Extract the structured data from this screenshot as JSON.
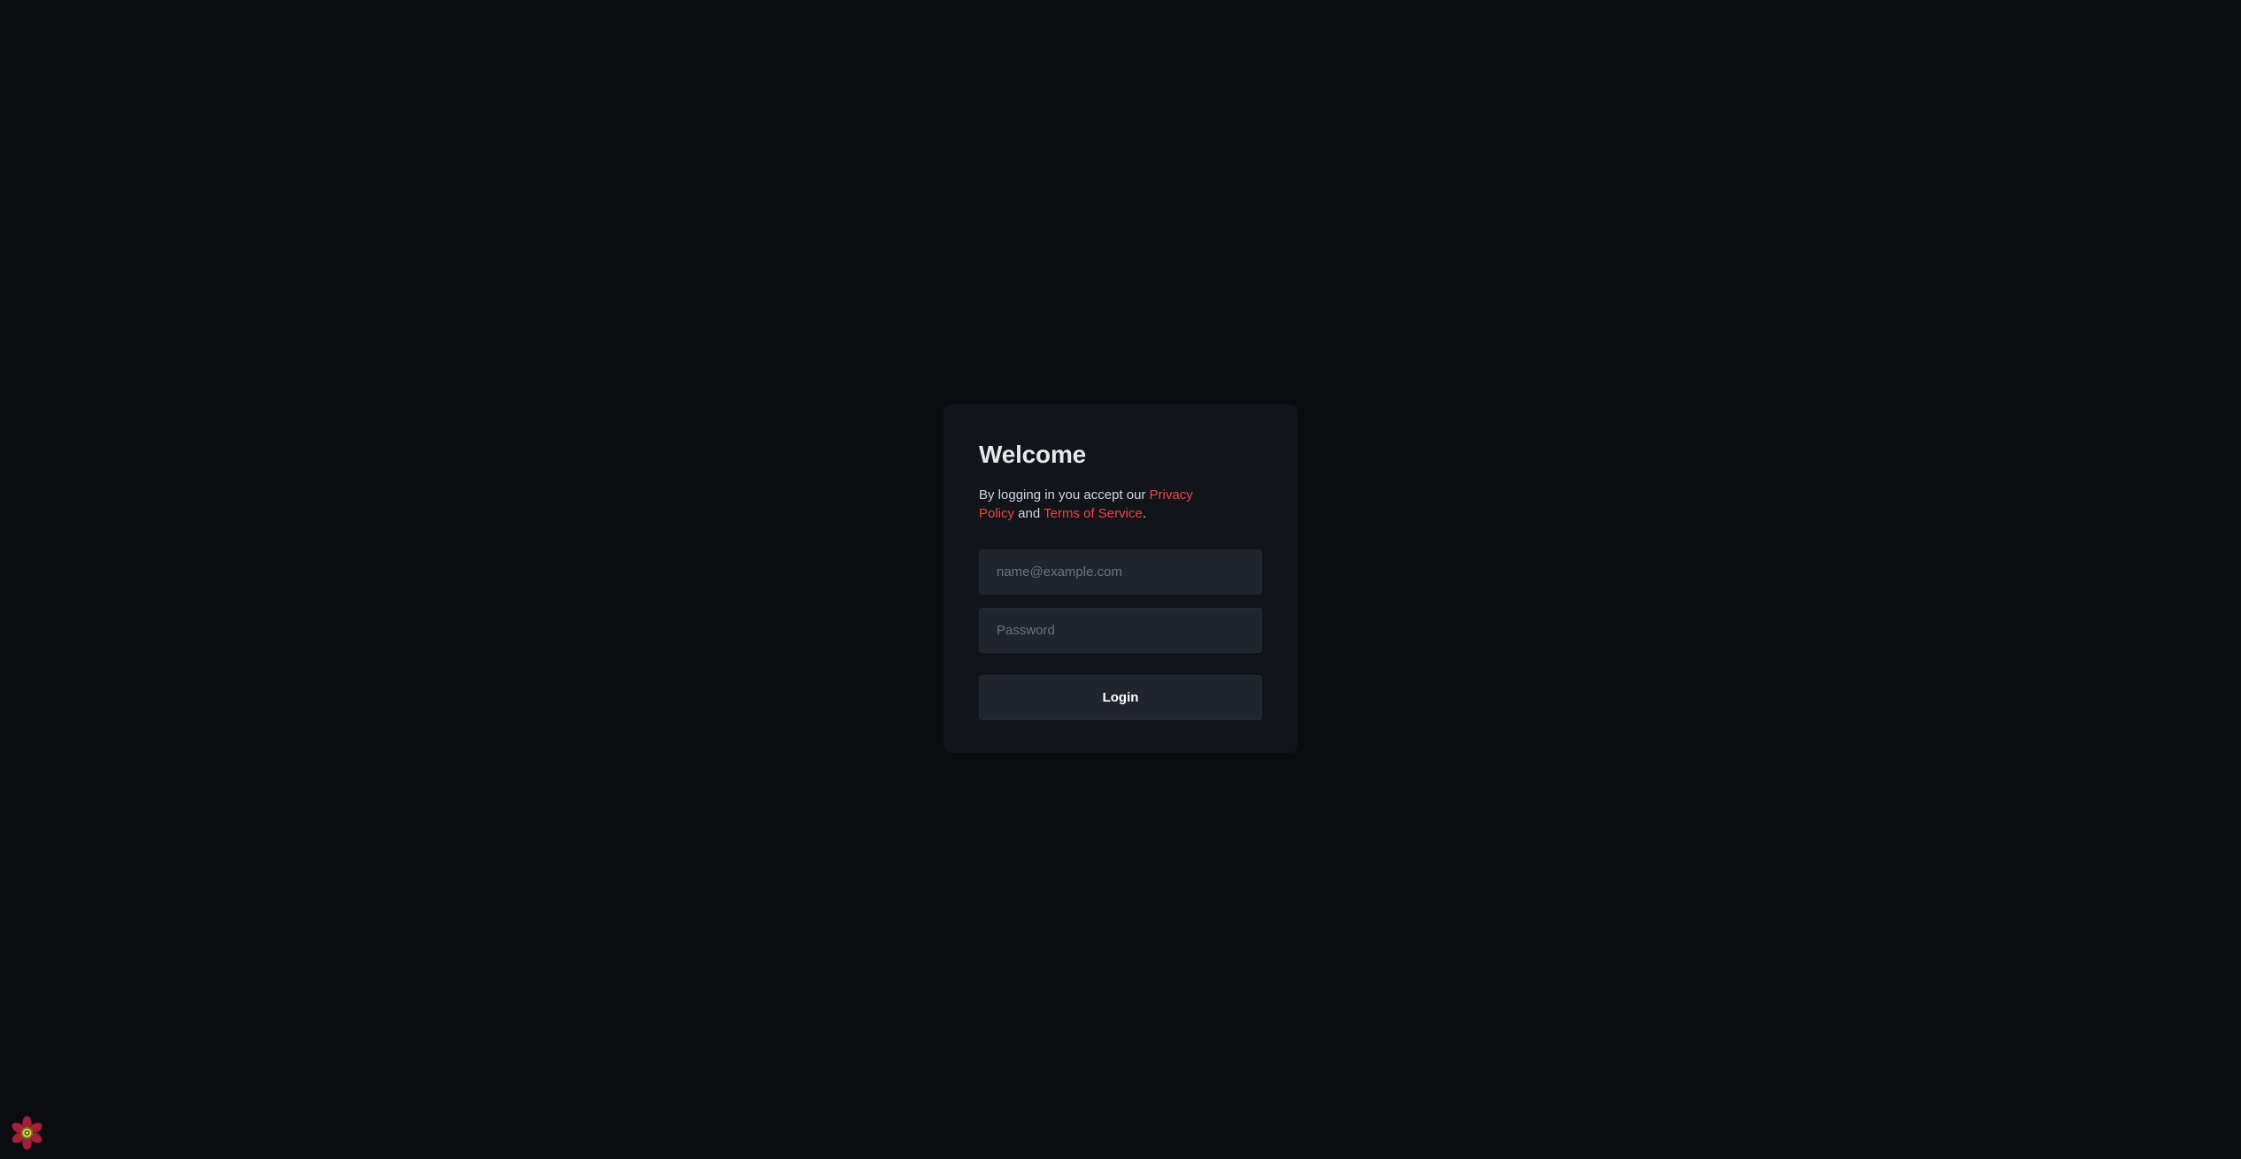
{
  "login": {
    "title": "Welcome",
    "terms_prefix": "By logging in you accept our ",
    "privacy_link": "Privacy Policy",
    "terms_middle": " and ",
    "tos_link": "Terms of Service",
    "terms_suffix": ".",
    "email_placeholder": "name@example.com",
    "password_placeholder": "Password",
    "login_button": "Login"
  },
  "colors": {
    "background": "#0a0c10",
    "card": "#111419",
    "input": "#1f242d",
    "link": "#ef4444",
    "logo_petals": "#a3213b",
    "logo_center": "#e6c84a"
  },
  "icons": {
    "corner_logo": "flower-logo-icon"
  }
}
